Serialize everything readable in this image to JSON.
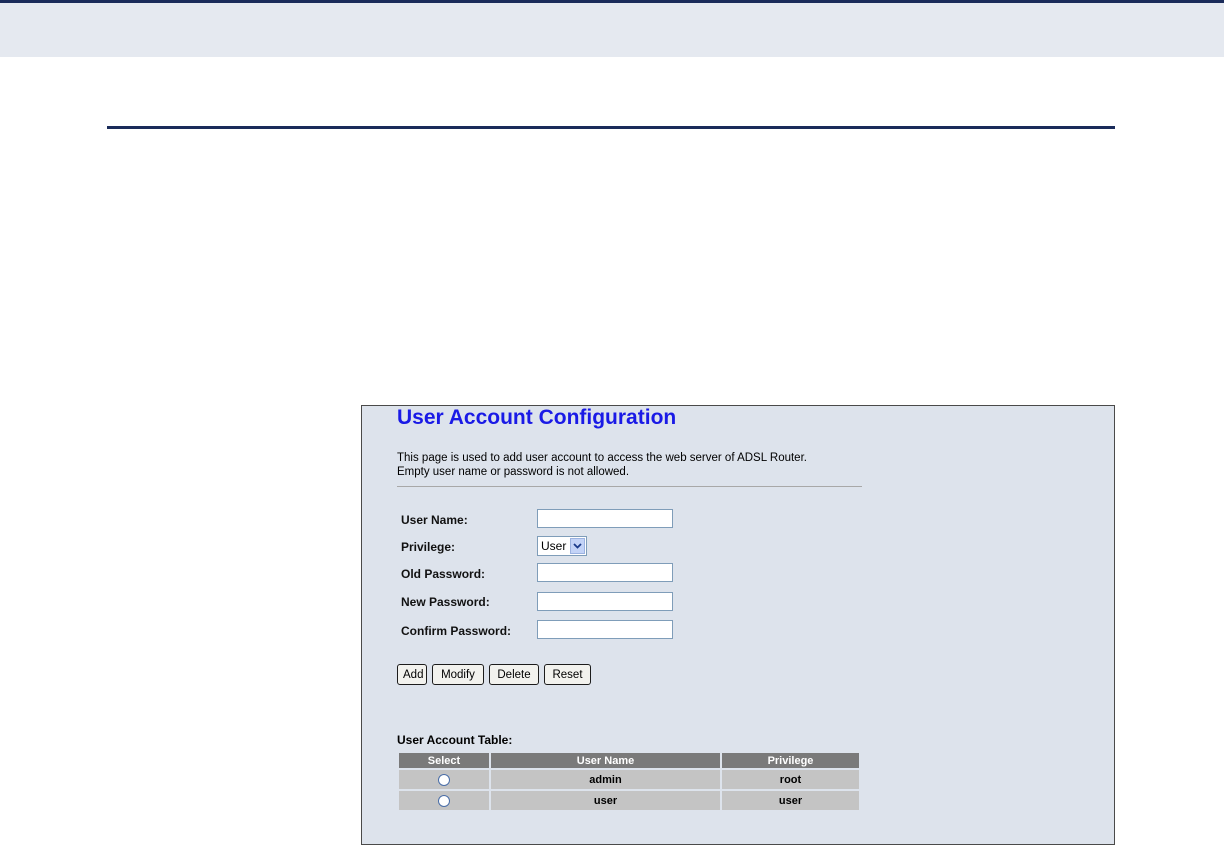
{
  "page": {
    "title": "User Account Configuration",
    "description_line1": "This page is used to add user account to access the web server of ADSL Router.",
    "description_line2": "Empty user name or password is not allowed."
  },
  "form": {
    "user_name_label": "User Name:",
    "user_name_value": "",
    "privilege_label": "Privilege:",
    "privilege_value": "User",
    "old_password_label": "Old Password:",
    "old_password_value": "",
    "new_password_label": "New Password:",
    "new_password_value": "",
    "confirm_password_label": "Confirm Password:",
    "confirm_password_value": ""
  },
  "buttons": {
    "add": "Add",
    "modify": "Modify",
    "delete": "Delete",
    "reset": "Reset"
  },
  "table": {
    "title": "User Account Table:",
    "headers": [
      "Select",
      "User Name",
      "Privilege"
    ],
    "rows": [
      {
        "user_name": "admin",
        "privilege": "root"
      },
      {
        "user_name": "user",
        "privilege": "user"
      }
    ]
  },
  "colors": {
    "title": "#1a1ae6",
    "panel_background": "#dde3ec",
    "header_band": "#e5e9f0",
    "rule": "#1a2b5a"
  },
  "icons": {
    "select_arrow": "chevron-down-icon",
    "row_select": "radio-button"
  }
}
